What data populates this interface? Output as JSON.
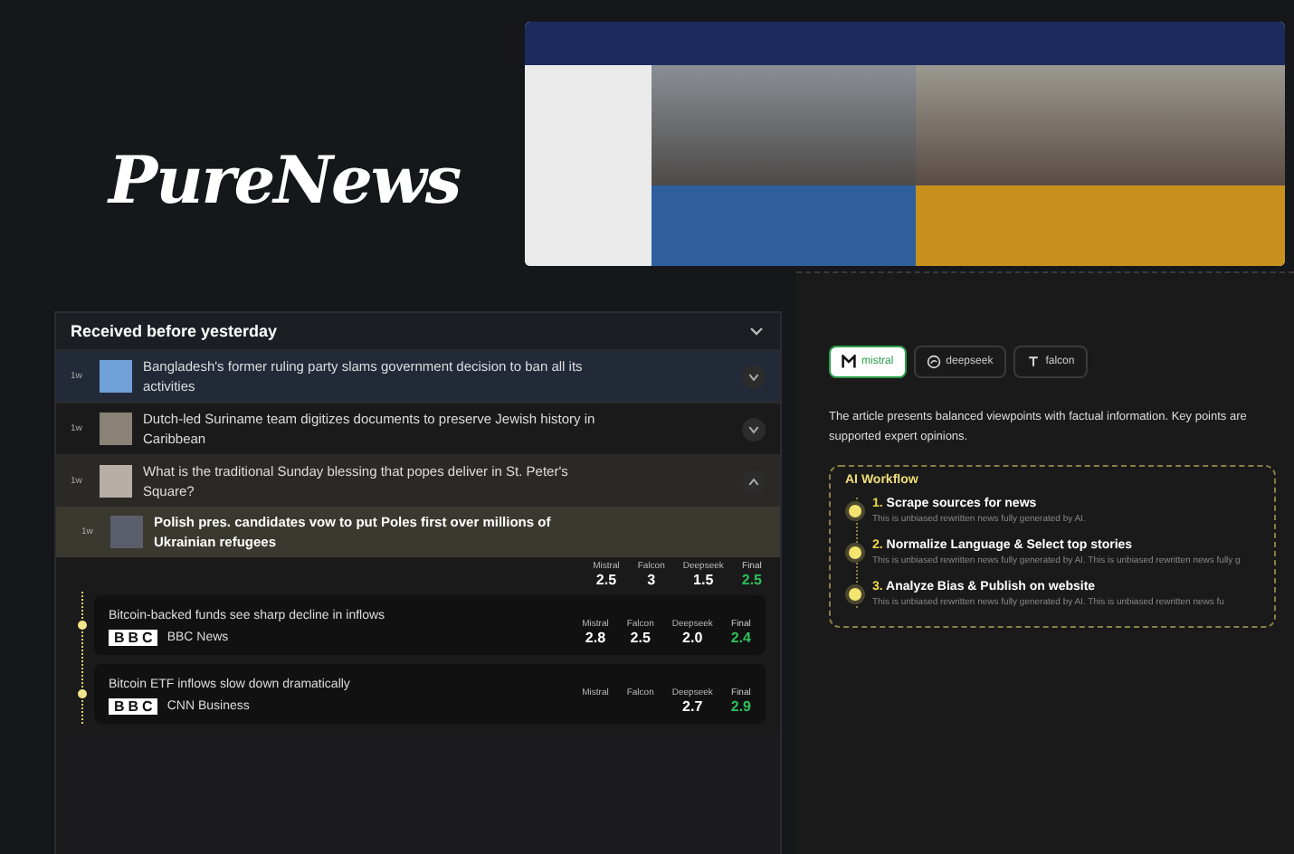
{
  "brand": {
    "name": "PureNews"
  },
  "feed": {
    "heading": "Received before yesterday",
    "expanded": false,
    "items": [
      {
        "time": "1w",
        "title": "Bangladesh's former ruling party slams government decision to ban all its activities",
        "selected": true,
        "expanded": false
      },
      {
        "time": "1w",
        "title": "Dutch-led Suriname team digitizes documents to preserve Jewish history in Caribbean",
        "selected": false,
        "expanded": false
      },
      {
        "time": "1w",
        "title": "What is the traditional Sunday blessing that popes deliver in St. Peter's Square?",
        "selected": false,
        "expanded": true,
        "details": {
          "headline": {
            "time": "1w",
            "title": "Polish pres. candidates vow to put Poles first over millions of Ukrainian refugees"
          },
          "scores": [
            {
              "label": "Mistral",
              "value": "2.5",
              "kind": "model"
            },
            {
              "label": "Falcon",
              "value": "3",
              "kind": "model"
            },
            {
              "label": "Deepseek",
              "value": "1.5",
              "kind": "model"
            },
            {
              "label": "Final",
              "value": "2.5",
              "kind": "final"
            }
          ],
          "stories": [
            {
              "title": "Bitcoin-backed funds see sharp decline in inflows",
              "logo": "BBC",
              "source": "BBC News",
              "scores": [
                {
                  "label": "Mistral",
                  "value": "2.8",
                  "kind": "model"
                },
                {
                  "label": "Falcon",
                  "value": "2.5",
                  "kind": "model"
                },
                {
                  "label": "Deepseek",
                  "value": "2.0",
                  "kind": "model"
                },
                {
                  "label": "Final",
                  "value": "2.4",
                  "kind": "final"
                }
              ]
            },
            {
              "title": "Bitcoin ETF inflows slow down dramatically",
              "logo": "BBC",
              "source": "CNN Business",
              "scores": [
                {
                  "label": "Mistral",
                  "kind": "model"
                },
                {
                  "label": "Falcon",
                  "kind": "model"
                },
                {
                  "label": "Deepseek",
                  "value": "2.7",
                  "kind": "model"
                },
                {
                  "label": "Final",
                  "value": "2.9",
                  "kind": "final"
                }
              ]
            }
          ]
        }
      }
    ]
  },
  "analysis": {
    "tabs": [
      {
        "label": "mistral",
        "selected": true
      },
      {
        "label": "deepseek",
        "selected": false
      },
      {
        "label": "falcon",
        "selected": false
      }
    ],
    "summary": "The article presents balanced viewpoints with factual information. Key points are supported expert opinions.",
    "workflow": {
      "title": "AI Workflow",
      "steps": [
        {
          "number": "1.",
          "title": "Scrape sources for news",
          "description": "This is unbiased rewritten news fully generated by AI."
        },
        {
          "number": "2.",
          "title": "Normalize Language & Select top stories",
          "description": "This is unbiased rewritten news fully generated by AI. This is unbiased rewritten news fully g"
        },
        {
          "number": "3.",
          "title": "Analyze Bias & Publish on website",
          "description": "This is unbiased rewritten news fully generated by AI. This is unbiased rewritten news fu"
        }
      ]
    }
  }
}
